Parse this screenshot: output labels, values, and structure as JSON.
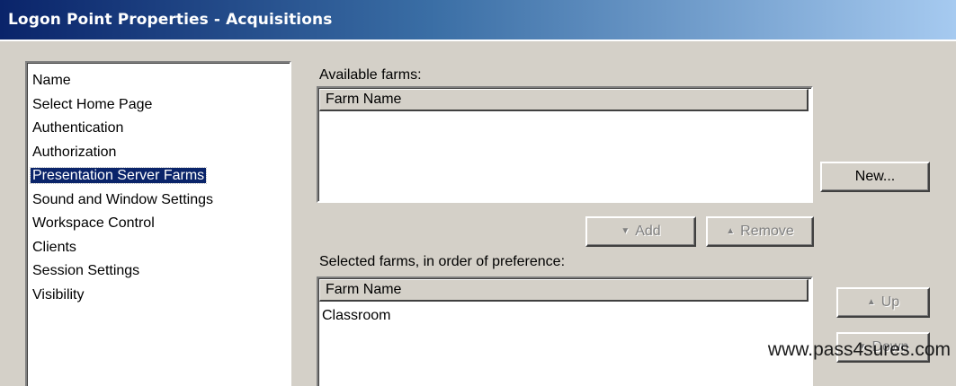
{
  "window": {
    "title": "Logon Point Properties - Acquisitions"
  },
  "nav": {
    "items": [
      {
        "label": "Name",
        "selected": false
      },
      {
        "label": "Select Home Page",
        "selected": false
      },
      {
        "label": "Authentication",
        "selected": false
      },
      {
        "label": "Authorization",
        "selected": false
      },
      {
        "label": "Presentation Server Farms",
        "selected": true
      },
      {
        "label": "Sound and Window Settings",
        "selected": false
      },
      {
        "label": "Workspace Control",
        "selected": false
      },
      {
        "label": "Clients",
        "selected": false
      },
      {
        "label": "Session Settings",
        "selected": false
      },
      {
        "label": "Visibility",
        "selected": false
      }
    ]
  },
  "available_farms": {
    "label": "Available farms:",
    "column_header": "Farm Name",
    "rows": []
  },
  "selected_farms": {
    "label": "Selected farms, in order of preference:",
    "column_header": "Farm Name",
    "rows": [
      "Classroom"
    ]
  },
  "buttons": {
    "new_label": "New...",
    "add_label": "Add",
    "remove_label": "Remove",
    "up_label": "Up",
    "down_label": "Down"
  },
  "watermark": {
    "text": "www.pass4sures.com"
  }
}
